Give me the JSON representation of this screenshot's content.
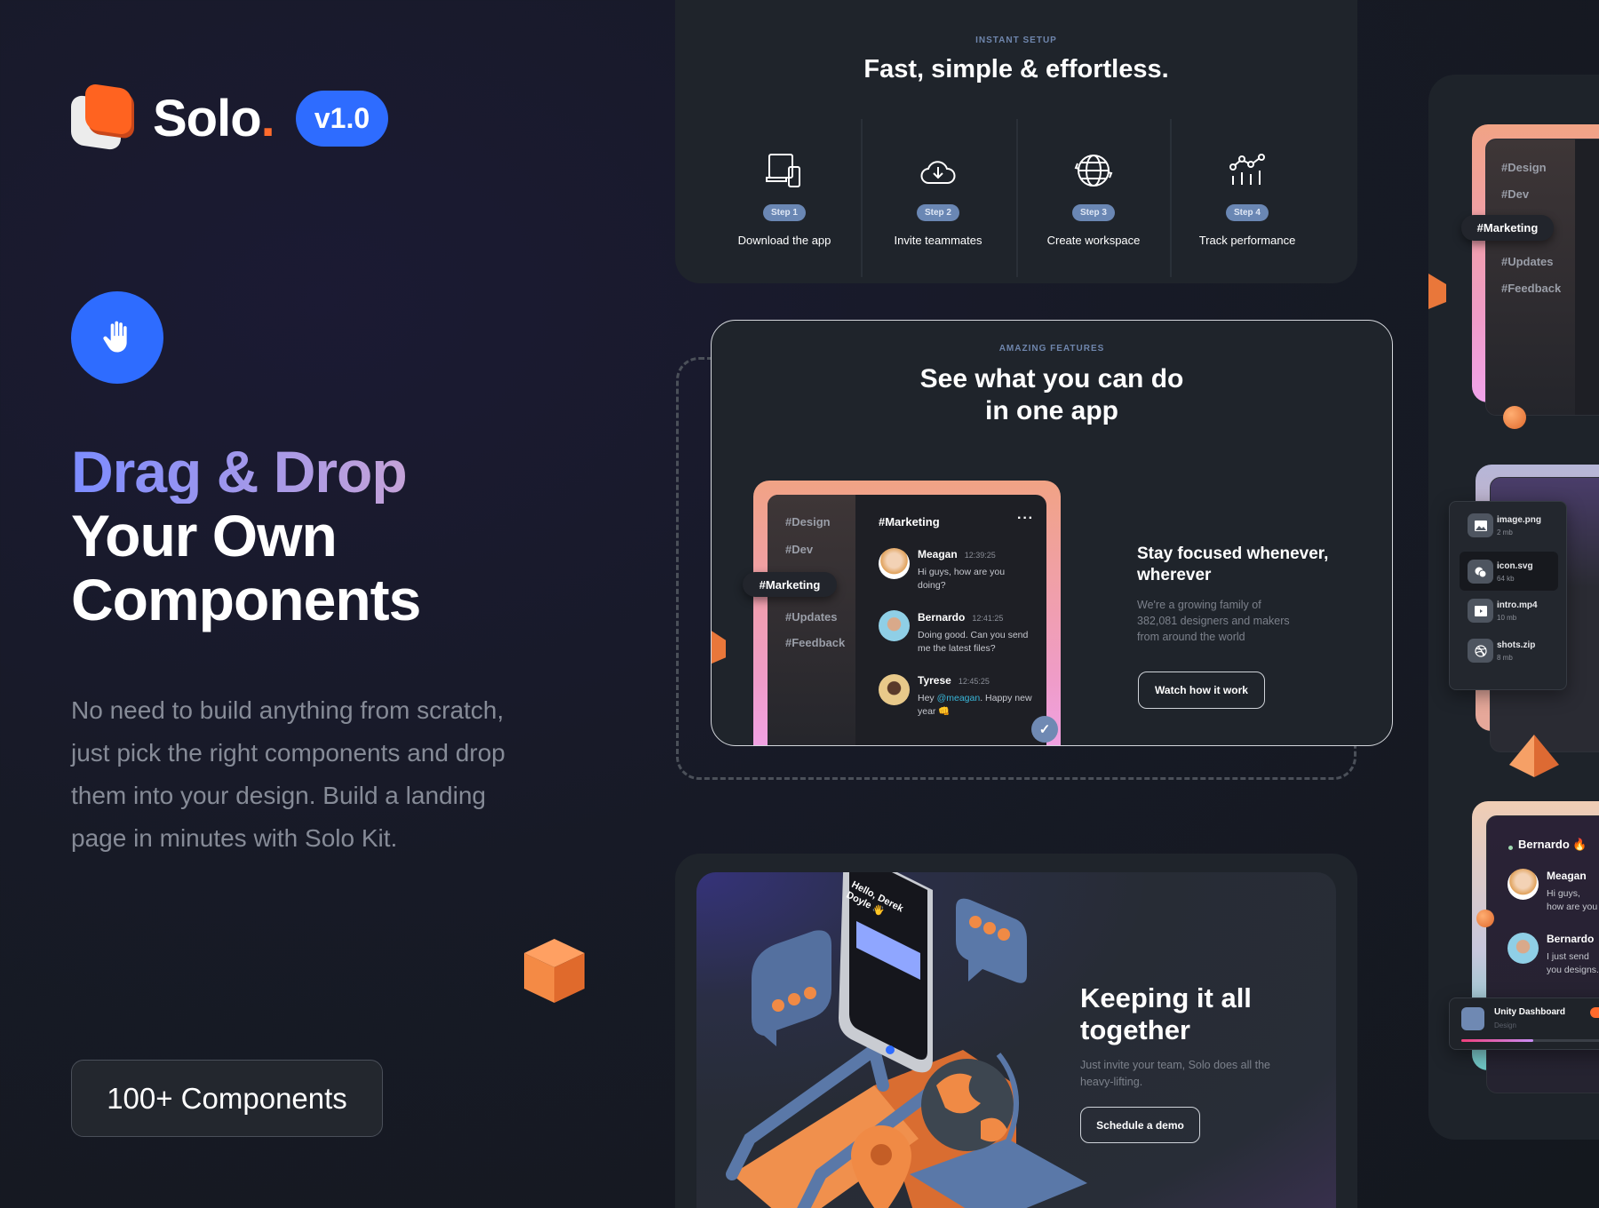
{
  "brand": {
    "name": "Solo",
    "dot": ".",
    "version": "v1.0"
  },
  "hero": {
    "icon": "hand-icon",
    "title_line1": "Drag & Drop",
    "title_line2": "Your Own",
    "title_line3": "Components",
    "description": "No need to build anything from scratch, just pick the right components and drop them into your design. Build a landing page in minutes with Solo Kit.",
    "cta": "100+ Components"
  },
  "setup": {
    "eyebrow": "INSTANT SETUP",
    "title": "Fast, simple & effortless.",
    "steps": [
      {
        "badge": "Step 1",
        "label": "Download the app",
        "icon": "devices-icon"
      },
      {
        "badge": "Step 2",
        "label": "Invite teammates",
        "icon": "cloud-download-icon"
      },
      {
        "badge": "Step 3",
        "label": "Create workspace",
        "icon": "globe-icon"
      },
      {
        "badge": "Step 4",
        "label": "Track performance",
        "icon": "chart-icon"
      }
    ]
  },
  "features": {
    "eyebrow": "AMAZING FEATURES",
    "title_line1": "See what you can do",
    "title_line2": "in one app",
    "channels": [
      "#Design",
      "#Dev",
      "#Marketing",
      "#Updates",
      "#Feedback"
    ],
    "chat_title": "#Marketing",
    "messages": [
      {
        "name": "Meagan",
        "time": "12:39:25",
        "text": "Hi guys, how are you doing?"
      },
      {
        "name": "Bernardo",
        "time": "12:41:25",
        "text": "Doing good. Can you send me the latest files?"
      },
      {
        "name": "Tyrese",
        "time": "12:45:25",
        "text_before": "Hey ",
        "mention": "@meagan",
        "text_after": ". Happy new year 👊"
      }
    ],
    "side_title": "Stay focused whenever, wherever",
    "side_text": "We're a growing family of 382,081 designers and makers from around the world",
    "button": "Watch how it work"
  },
  "together": {
    "title": "Keeping it all together",
    "text": "Just invite your team, Solo does all the heavy-lifting.",
    "button": "Schedule a demo",
    "phone": {
      "greeting": "Hello, Derek Doyle 👋"
    }
  },
  "side_panel": {
    "channels": [
      "#Design",
      "#Dev",
      "#Marketing",
      "#Updates",
      "#Feedback"
    ],
    "files": [
      {
        "name": "image.png",
        "size": "2 mb",
        "icon": "image-icon"
      },
      {
        "name": "icon.svg",
        "size": "64 kb",
        "icon": "shapes-icon"
      },
      {
        "name": "intro.mp4",
        "size": "10 mb",
        "icon": "video-icon"
      },
      {
        "name": "shots.zip",
        "size": "8 mb",
        "icon": "dribbble-icon"
      }
    ],
    "chat_header": "Bernardo 🔥",
    "messages": [
      {
        "name": "Meagan",
        "text": "Hi guys, how are you doing?"
      },
      {
        "name": "Bernardo",
        "text": "I just send you designs."
      }
    ],
    "task": {
      "title": "Unity Dashboard",
      "subtitle": "Design",
      "progress_percent": 45
    }
  },
  "colors": {
    "accent": "#2e6cff",
    "orange": "#ff6320",
    "card": "#1f242b",
    "step_pill": "#6a87b4"
  }
}
